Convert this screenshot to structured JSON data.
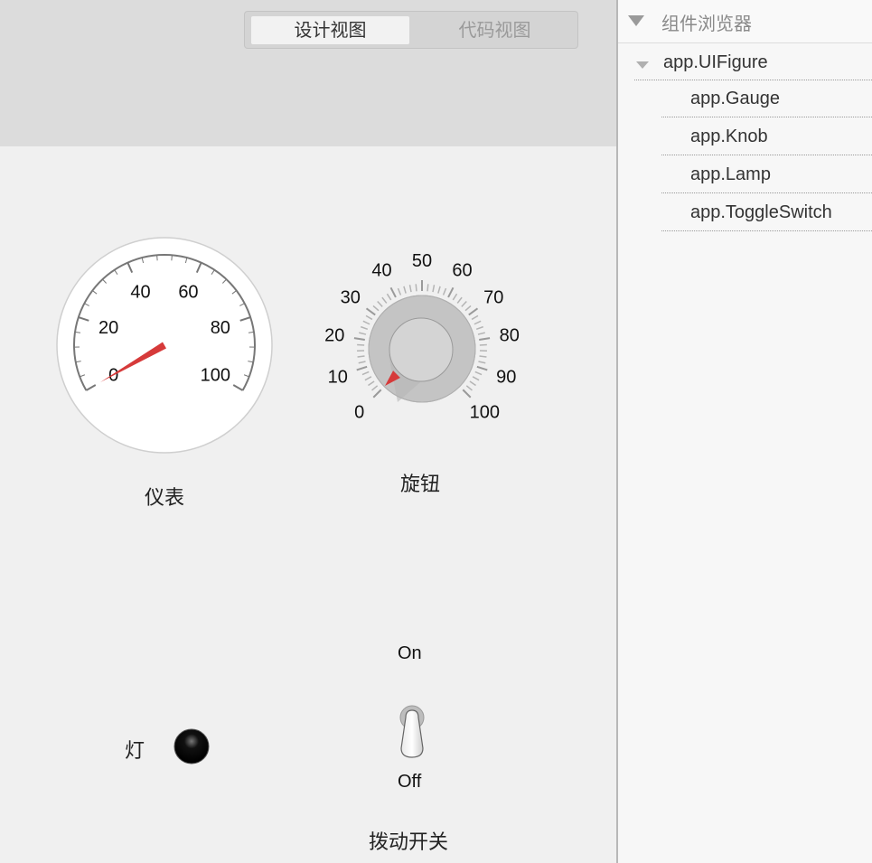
{
  "view_switcher": {
    "design_view": "设计视图",
    "code_view": "代码视图"
  },
  "component_browser": {
    "title": "组件浏览器",
    "root": "app.UIFigure",
    "items": [
      "app.Gauge",
      "app.Knob",
      "app.Lamp",
      "app.ToggleSwitch"
    ]
  },
  "gauge": {
    "label": "仪表",
    "min": 0,
    "max": 100,
    "tick_labels": [
      "0",
      "20",
      "40",
      "60",
      "80",
      "100"
    ],
    "value": 0,
    "needle_color": "#d63a3a"
  },
  "knob": {
    "label": "旋钮",
    "min": 0,
    "max": 100,
    "tick_labels": [
      "0",
      "10",
      "20",
      "30",
      "40",
      "50",
      "60",
      "70",
      "80",
      "90",
      "100"
    ],
    "value": 0,
    "indicator_color": "#d63a3a"
  },
  "lamp": {
    "label": "灯",
    "state": "off",
    "color": "#000000"
  },
  "toggle_switch": {
    "label": "拨动开关",
    "on_label": "On",
    "off_label": "Off",
    "value": "Off"
  }
}
